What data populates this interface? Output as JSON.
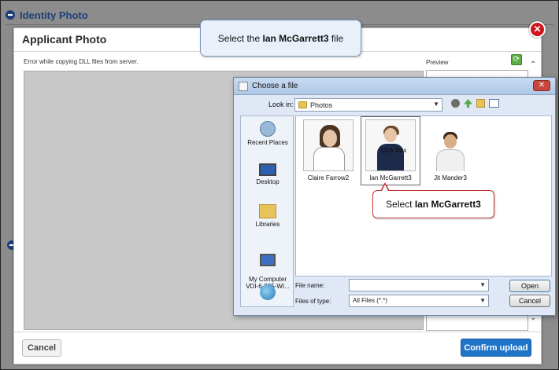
{
  "page": {
    "section_title": "Identity Photo"
  },
  "modal": {
    "title": "Applicant Photo",
    "error_text": "Error while copying DLL files from server.",
    "preview_label": "Preview",
    "close_symbol": "✕",
    "cancel_label": "Cancel",
    "confirm_label": "Confirm upload"
  },
  "callouts": {
    "top_prefix": "Select the ",
    "top_bold": "Ian McGarrett3",
    "top_suffix": " file",
    "bottom_prefix": "Select ",
    "bottom_bold": "Ian McGarrett3"
  },
  "dialog": {
    "title": "Choose a file",
    "close_symbol": "✕",
    "look_in_label": "Look in:",
    "look_in_value": "Photos",
    "places": [
      {
        "label": "Recent Places",
        "icon": "recent-places-icon"
      },
      {
        "label": "Desktop",
        "icon": "desktop-icon"
      },
      {
        "label": "Libraries",
        "icon": "libraries-icon"
      },
      {
        "label": "My Computer\nVDI-6-305-WI...",
        "icon": "computer-icon"
      },
      {
        "label": "",
        "icon": "network-icon"
      }
    ],
    "files": [
      {
        "name": "Claire Farrow2"
      },
      {
        "name": "Ian McGarrett3",
        "overlay": "Click Box"
      },
      {
        "name": "Jit Mander3"
      }
    ],
    "file_name_label": "File name:",
    "file_name_value": "",
    "files_of_type_label": "Files of type:",
    "files_of_type_value": "All Files (*.*)",
    "open_label": "Open",
    "cancel_label": "Cancel"
  },
  "colors": {
    "accent_blue": "#1f73c8",
    "close_red": "#d0161c",
    "callout_border_red": "#c43333",
    "section_title_blue": "#1d3f7a"
  }
}
